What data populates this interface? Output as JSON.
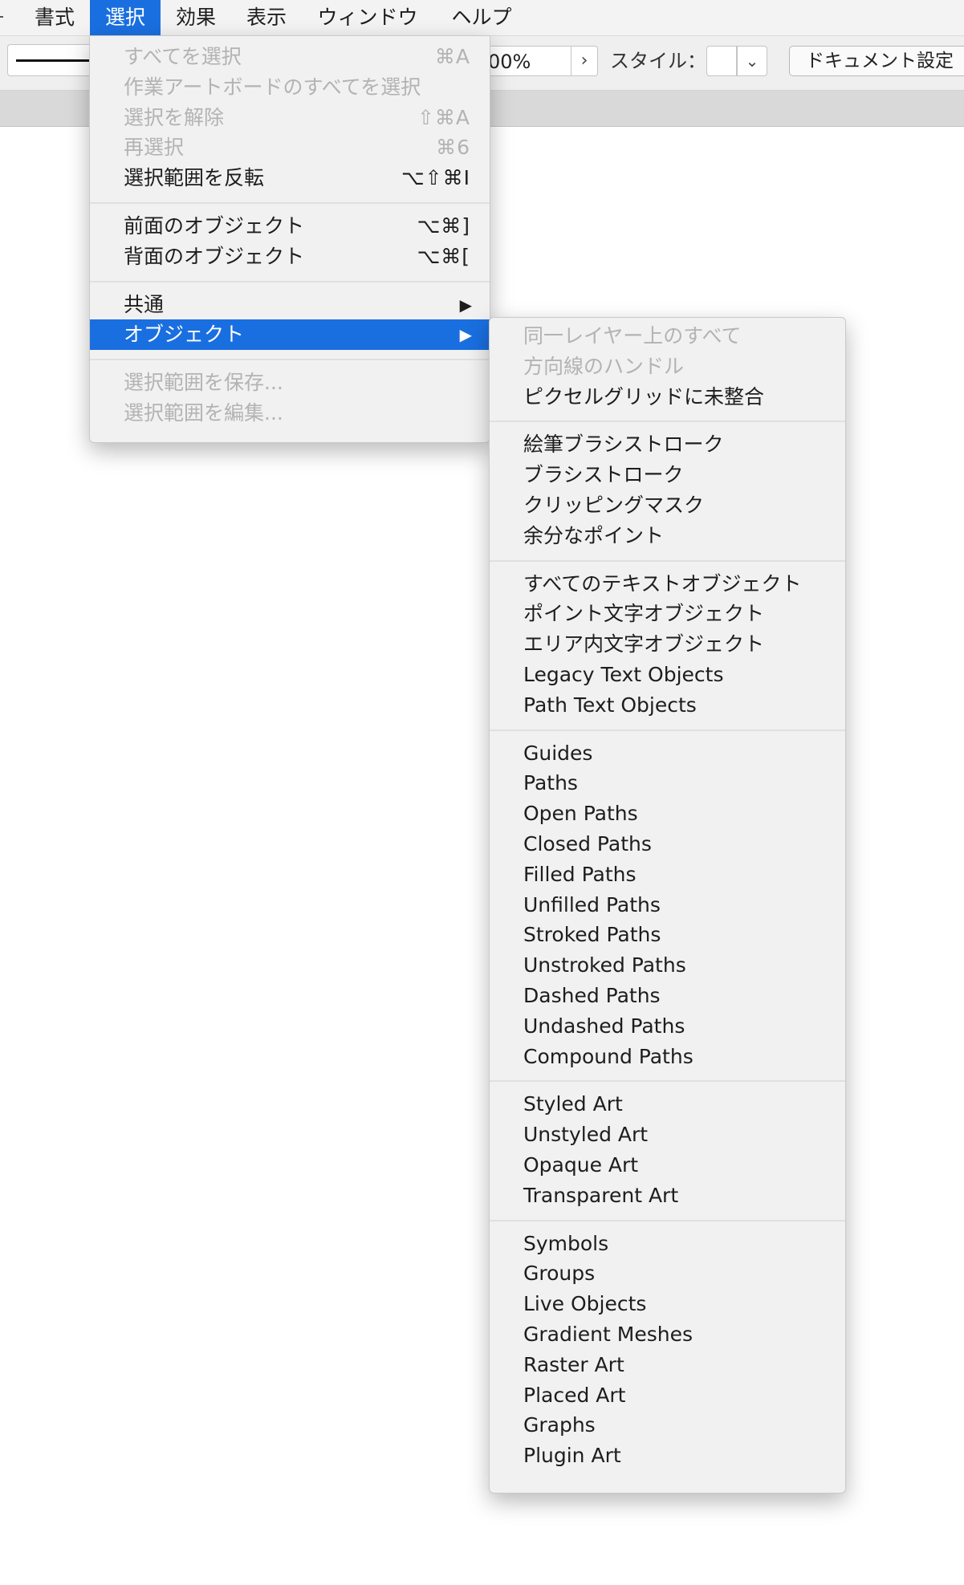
{
  "menubar": {
    "items": [
      "書式",
      "選択",
      "効果",
      "表示",
      "ウィンドウ",
      "ヘルプ"
    ],
    "active_index": 1,
    "active_color": "#1a6fe0"
  },
  "toolbar": {
    "zoom_value": "00%",
    "zoom_arrow": "›",
    "style_label": "スタイル：",
    "style_dropdown_icon": "⌄",
    "document_settings": "ドキュメント設定"
  },
  "select_menu": {
    "groups": [
      [
        {
          "label": "すべてを選択",
          "shortcut": "⌘A",
          "disabled": true
        },
        {
          "label": "作業アートボードのすべてを選択",
          "shortcut": "",
          "disabled": true
        },
        {
          "label": "選択を解除",
          "shortcut": "⇧⌘A",
          "disabled": true
        },
        {
          "label": "再選択",
          "shortcut": "⌘6",
          "disabled": true
        },
        {
          "label": "選択範囲を反転",
          "shortcut": "⌥⇧⌘I",
          "disabled": false
        }
      ],
      [
        {
          "label": "前面のオブジェクト",
          "shortcut": "⌥⌘]",
          "disabled": false
        },
        {
          "label": "背面のオブジェクト",
          "shortcut": "⌥⌘[",
          "disabled": false
        }
      ],
      [
        {
          "label": "共通",
          "submenu": true,
          "disabled": false
        },
        {
          "label": "オブジェクト",
          "submenu": true,
          "disabled": false,
          "highlighted": true
        }
      ],
      [
        {
          "label": "選択範囲を保存...",
          "disabled": true
        },
        {
          "label": "選択範囲を編集...",
          "disabled": true
        }
      ]
    ],
    "submenu_arrow": "▶"
  },
  "object_submenu": {
    "groups": [
      [
        {
          "label": "同一レイヤー上のすべて",
          "disabled": true
        },
        {
          "label": "方向線のハンドル",
          "disabled": true
        },
        {
          "label": "ピクセルグリッドに未整合",
          "disabled": false
        }
      ],
      [
        {
          "label": "絵筆ブラシストローク"
        },
        {
          "label": "ブラシストローク"
        },
        {
          "label": "クリッピングマスク"
        },
        {
          "label": "余分なポイント"
        }
      ],
      [
        {
          "label": "すべてのテキストオブジェクト"
        },
        {
          "label": "ポイント文字オブジェクト"
        },
        {
          "label": "エリア内文字オブジェクト"
        },
        {
          "label": "Legacy Text Objects"
        },
        {
          "label": "Path Text Objects"
        }
      ],
      [
        {
          "label": "Guides"
        },
        {
          "label": "Paths"
        },
        {
          "label": "Open Paths"
        },
        {
          "label": "Closed Paths"
        },
        {
          "label": "Filled Paths"
        },
        {
          "label": "Unfilled Paths"
        },
        {
          "label": "Stroked Paths"
        },
        {
          "label": "Unstroked Paths"
        },
        {
          "label": "Dashed Paths"
        },
        {
          "label": "Undashed Paths"
        },
        {
          "label": "Compound Paths"
        }
      ],
      [
        {
          "label": "Styled Art"
        },
        {
          "label": "Unstyled Art"
        },
        {
          "label": "Opaque Art"
        },
        {
          "label": "Transparent Art"
        }
      ],
      [
        {
          "label": "Symbols"
        },
        {
          "label": "Groups"
        },
        {
          "label": "Live Objects"
        },
        {
          "label": "Gradient Meshes"
        },
        {
          "label": "Raster Art"
        },
        {
          "label": "Placed Art"
        },
        {
          "label": "Graphs"
        },
        {
          "label": "Plugin Art"
        }
      ]
    ]
  }
}
